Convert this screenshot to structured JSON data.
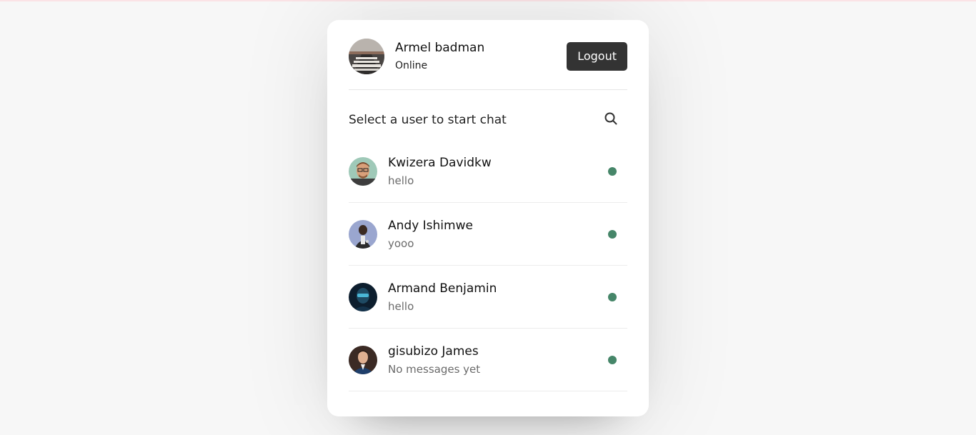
{
  "colors": {
    "online": "#468669",
    "logout_bg": "#333333",
    "page_bg": "#f7f7f7"
  },
  "header": {
    "name": "Armel badman",
    "status": "Online",
    "logout_label": "Logout",
    "avatar_icon": "profile-photo"
  },
  "search": {
    "text": "Select a user to start chat",
    "icon": "search-icon"
  },
  "users": [
    {
      "name": "Kwizera Davidkw",
      "message": "hello",
      "status": "online"
    },
    {
      "name": "Andy Ishimwe",
      "message": "yooo",
      "status": "online"
    },
    {
      "name": "Armand Benjamin",
      "message": "hello",
      "status": "online"
    },
    {
      "name": "gisubizo James",
      "message": "No messages yet",
      "status": "online"
    }
  ]
}
